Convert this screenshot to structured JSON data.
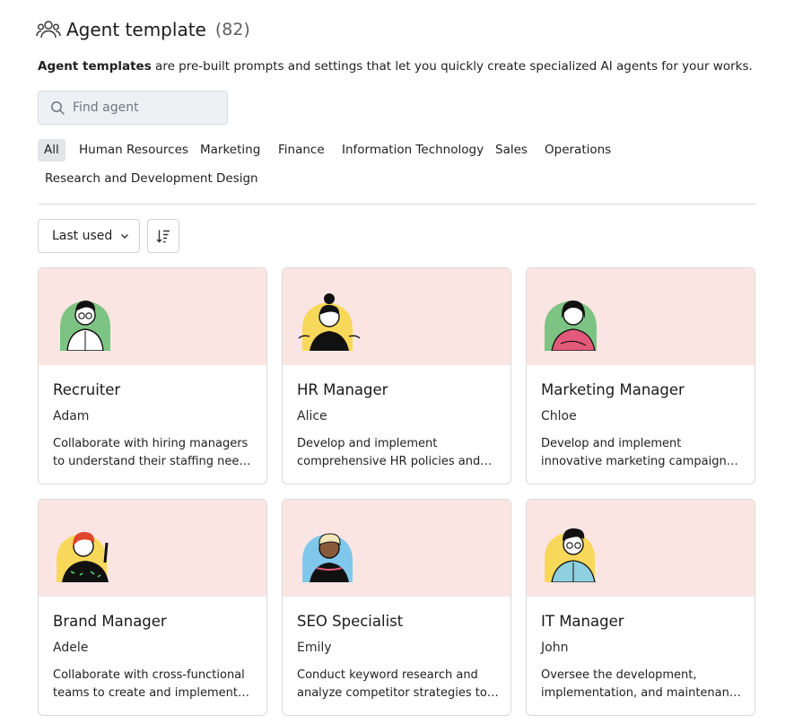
{
  "header": {
    "title": "Agent template",
    "count": "(82)",
    "icon": "people-icon"
  },
  "description": {
    "bold": "Agent templates",
    "rest": " are pre-built prompts and settings that let you quickly create specialized AI agents for your works."
  },
  "search": {
    "placeholder": "Find agent",
    "value": ""
  },
  "tabs": [
    {
      "label": "All",
      "active": true
    },
    {
      "label": "Human Resources"
    },
    {
      "label": "Marketing"
    },
    {
      "label": "Finance"
    },
    {
      "label": "Information Technology"
    },
    {
      "label": "Sales"
    },
    {
      "label": "Operations"
    },
    {
      "label": "Research and Development"
    },
    {
      "label": "Design"
    }
  ],
  "sort": {
    "selected": "Last used"
  },
  "colors": {
    "banner": "#fbe5e3",
    "active_tab": "#e3e5e8",
    "avatar_green": "#7dc383",
    "avatar_yellow": "#f8d85a",
    "avatar_blue": "#7fc8ec"
  },
  "cards": [
    {
      "title": "Recruiter",
      "person": "Adam",
      "description": "Collaborate with hiring managers to understand their staffing needs and develop effective recruitment strategies.",
      "avatar": "green"
    },
    {
      "title": "HR Manager",
      "person": "Alice",
      "description": "Develop and implement comprehensive HR policies and procedures to support the organization.",
      "avatar": "yellow"
    },
    {
      "title": "Marketing Manager",
      "person": "Chloe",
      "description": "Develop and implement innovative marketing campaigns across multiple channels.",
      "avatar": "green"
    },
    {
      "title": "Brand Manager",
      "person": "Adele",
      "description": "Collaborate with cross-functional teams to create and implement brand strategies.",
      "avatar": "yellow"
    },
    {
      "title": "SEO Specialist",
      "person": "Emily",
      "description": "Conduct keyword research and analyze competitor strategies to improve search rankings.",
      "avatar": "blue"
    },
    {
      "title": "IT Manager",
      "person": "John",
      "description": "Oversee the development, implementation, and maintenance of IT systems and infrastructure.",
      "avatar": "yellow"
    }
  ]
}
